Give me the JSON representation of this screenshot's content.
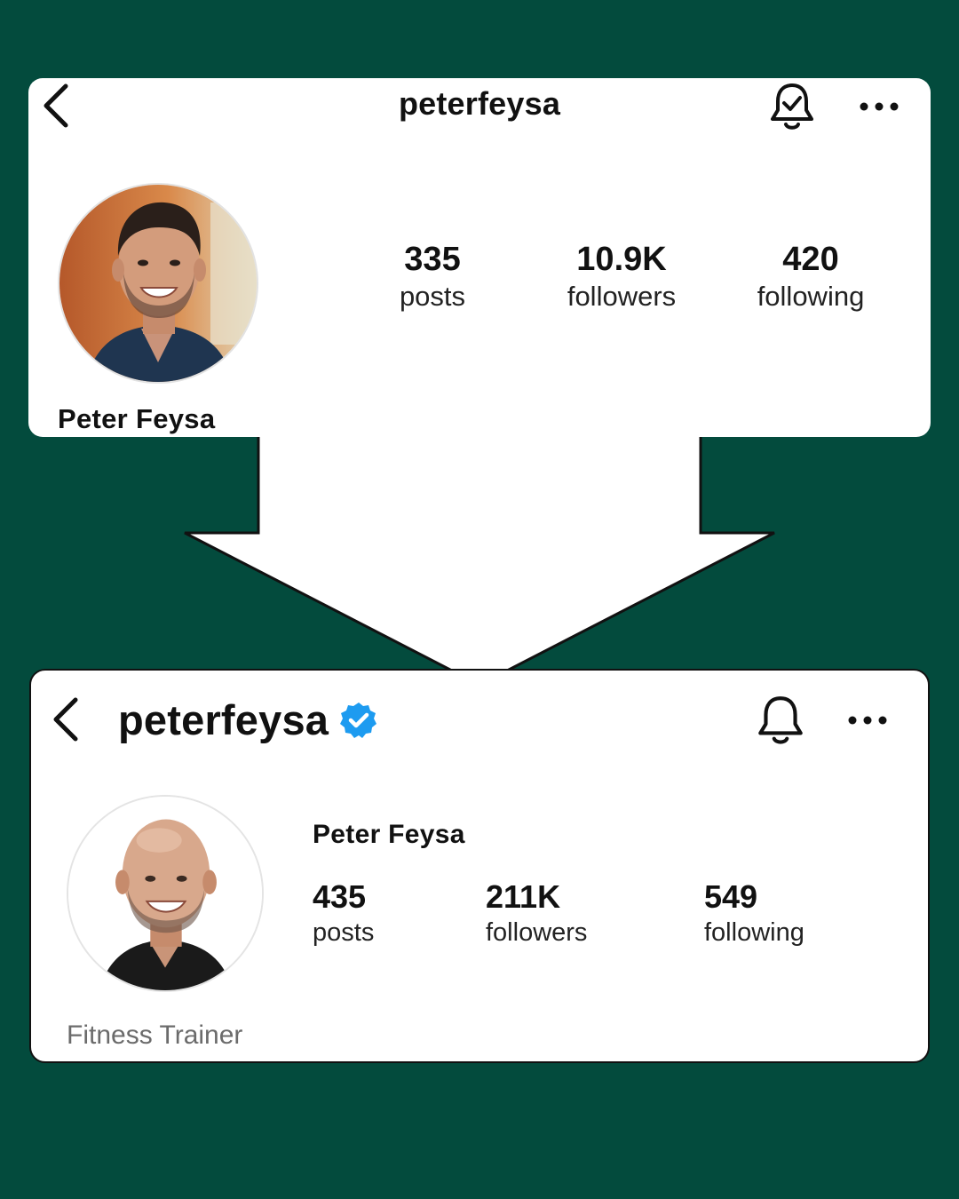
{
  "before": {
    "username": "peterfeysa",
    "display_name": "Peter Feysa",
    "stats": [
      {
        "value": "335",
        "label": "posts"
      },
      {
        "value": "10.9K",
        "label": "followers"
      },
      {
        "value": "420",
        "label": "following"
      }
    ],
    "icons": {
      "back": "chevron-left-icon",
      "notifications": "bell-check-icon",
      "more": "more-horizontal-icon"
    }
  },
  "after": {
    "username": "peterfeysa",
    "display_name": "Peter Feysa",
    "bio": "Fitness Trainer",
    "verified": true,
    "stats": [
      {
        "value": "435",
        "label": "posts"
      },
      {
        "value": "211K",
        "label": "followers"
      },
      {
        "value": "549",
        "label": "following"
      }
    ],
    "icons": {
      "back": "chevron-left-icon",
      "notifications": "bell-icon",
      "more": "more-horizontal-icon",
      "badge": "verified-badge-icon"
    }
  },
  "colors": {
    "background": "#034B3D",
    "card": "#FFFFFF",
    "verified": "#1D9BF0",
    "bio_text": "#6B6B6B"
  }
}
